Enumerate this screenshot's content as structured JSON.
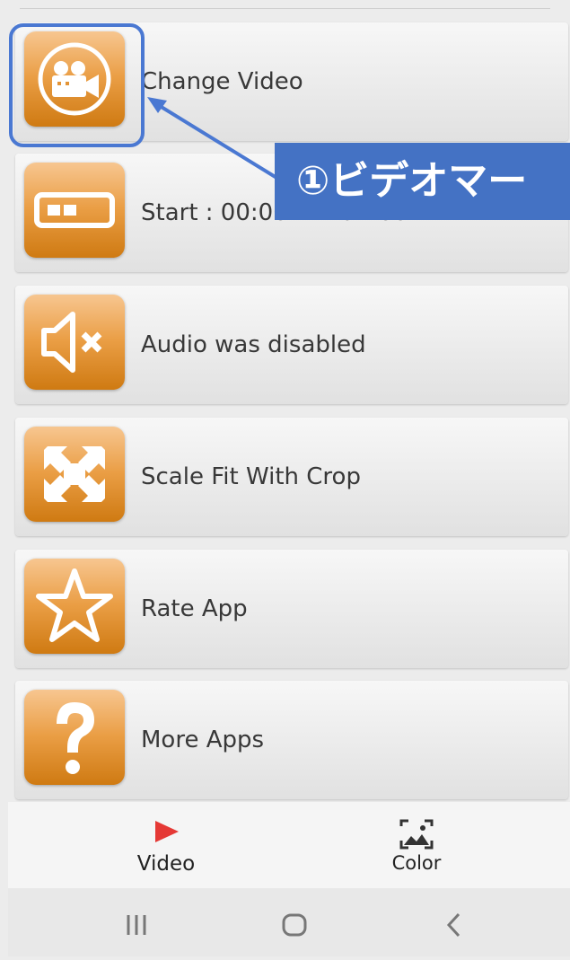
{
  "menu": {
    "items": [
      {
        "label": "Change Video",
        "icon": "video-camera-icon"
      },
      {
        "label": "Start : 00:00 - End : 00:12",
        "icon": "trim-range-icon"
      },
      {
        "label": "Audio was disabled",
        "icon": "speaker-muted-icon"
      },
      {
        "label": "Scale Fit With Crop",
        "icon": "scale-fit-icon"
      },
      {
        "label": "Rate App",
        "icon": "star-icon"
      },
      {
        "label": "More Apps",
        "icon": "question-mark-icon"
      }
    ]
  },
  "annotation": {
    "callout_text": "①ビデオマー",
    "color": "#4472c4"
  },
  "bottom_nav": {
    "tabs": [
      {
        "label": "Video",
        "icon": "play-icon",
        "active": true,
        "icon_color": "#e53935"
      },
      {
        "label": "Color",
        "icon": "image-icon",
        "active": false
      }
    ]
  },
  "system_nav": [
    "recent-apps-icon",
    "home-icon",
    "back-icon"
  ],
  "colors": {
    "tile_orange": "#e8913a",
    "accent_blue": "#4472c4"
  }
}
